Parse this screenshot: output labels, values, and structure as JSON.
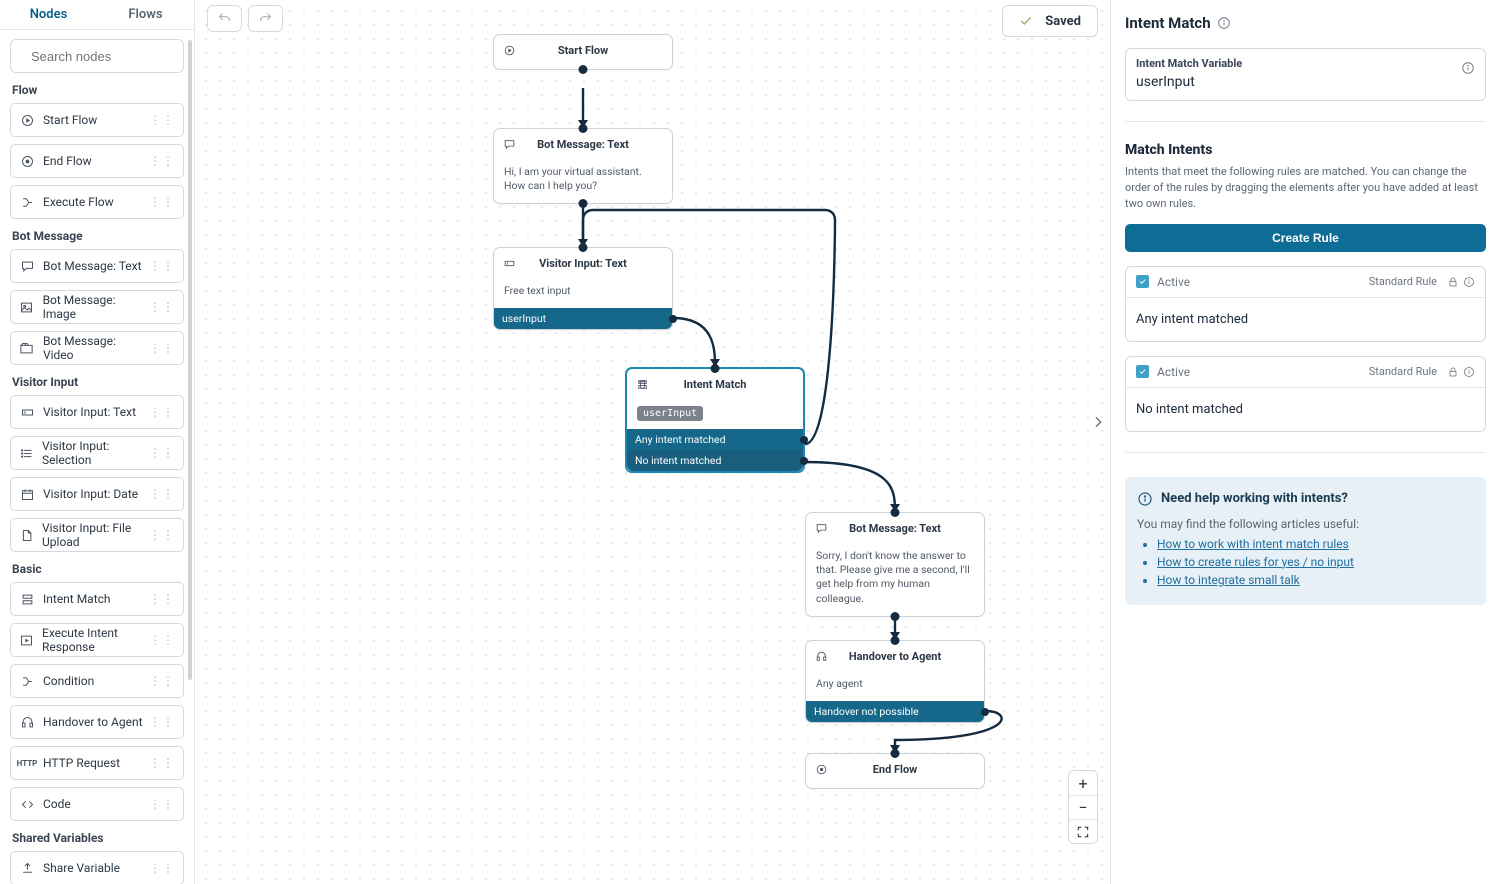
{
  "tabs": {
    "nodes": "Nodes",
    "flows": "Flows",
    "active": "nodes"
  },
  "search": {
    "placeholder": "Search nodes"
  },
  "sections": {
    "flow": {
      "title": "Flow",
      "items": [
        {
          "id": "start-flow",
          "label": "Start Flow",
          "icon": "play"
        },
        {
          "id": "end-flow",
          "label": "End Flow",
          "icon": "target"
        },
        {
          "id": "execute-flow",
          "label": "Execute Flow",
          "icon": "branch"
        }
      ]
    },
    "bot": {
      "title": "Bot Message",
      "items": [
        {
          "id": "bot-text",
          "label": "Bot Message: Text",
          "icon": "chat"
        },
        {
          "id": "bot-image",
          "label": "Bot Message: Image",
          "icon": "image"
        },
        {
          "id": "bot-video",
          "label": "Bot Message: Video",
          "icon": "video"
        }
      ]
    },
    "visitor": {
      "title": "Visitor Input",
      "items": [
        {
          "id": "vis-text",
          "label": "Visitor Input: Text",
          "icon": "input"
        },
        {
          "id": "vis-select",
          "label": "Visitor Input: Selection",
          "icon": "list"
        },
        {
          "id": "vis-date",
          "label": "Visitor Input: Date",
          "icon": "calendar"
        },
        {
          "id": "vis-file",
          "label": "Visitor Input: File Upload",
          "icon": "file"
        }
      ]
    },
    "basic": {
      "title": "Basic",
      "items": [
        {
          "id": "intent-match",
          "label": "Intent Match",
          "icon": "stack"
        },
        {
          "id": "exec-intent",
          "label": "Execute Intent Response",
          "icon": "play-box"
        },
        {
          "id": "condition",
          "label": "Condition",
          "icon": "branch"
        },
        {
          "id": "handover",
          "label": "Handover to Agent",
          "icon": "headset"
        },
        {
          "id": "http",
          "label": "HTTP Request",
          "icon": "http"
        },
        {
          "id": "code",
          "label": "Code",
          "icon": "code"
        }
      ]
    },
    "shared": {
      "title": "Shared Variables",
      "items": [
        {
          "id": "share-var",
          "label": "Share Variable",
          "icon": "upload"
        }
      ]
    }
  },
  "canvas": {
    "saved_label": "Saved",
    "nodes": {
      "start": {
        "title": "Start Flow"
      },
      "greet": {
        "title": "Bot Message: Text",
        "body": "Hi, I am your virtual assistant. How can I help you?"
      },
      "input": {
        "title": "Visitor Input: Text",
        "body": "Free text input",
        "outlet": "userInput"
      },
      "intent": {
        "title": "Intent Match",
        "chip": "userInput",
        "out1": "Any intent matched",
        "out2": "No intent matched"
      },
      "fallback": {
        "title": "Bot Message: Text",
        "body": "Sorry, I don't know the answer to that. Please give me a second, I'll get help from my human colleague."
      },
      "handover": {
        "title": "Handover to Agent",
        "body": "Any agent",
        "outlet": "Handover not possible"
      },
      "end": {
        "title": "End Flow"
      }
    }
  },
  "panel": {
    "title": "Intent Match",
    "var_label": "Intent Match Variable",
    "var_value": "userInput",
    "section_title": "Match Intents",
    "section_help": "Intents that meet the following rules are matched. You can change the order of the rules by dragging the elements after you have added at least two own rules.",
    "create_label": "Create Rule",
    "active_label": "Active",
    "std_label": "Standard Rule",
    "rules": [
      {
        "text": "Any intent matched"
      },
      {
        "text": "No intent matched"
      }
    ],
    "help": {
      "title": "Need help working with intents?",
      "sub": "You may find the following articles useful:",
      "links": [
        "How to work with intent match rules",
        "How to create rules for yes / no input",
        "How to integrate small talk"
      ]
    }
  }
}
